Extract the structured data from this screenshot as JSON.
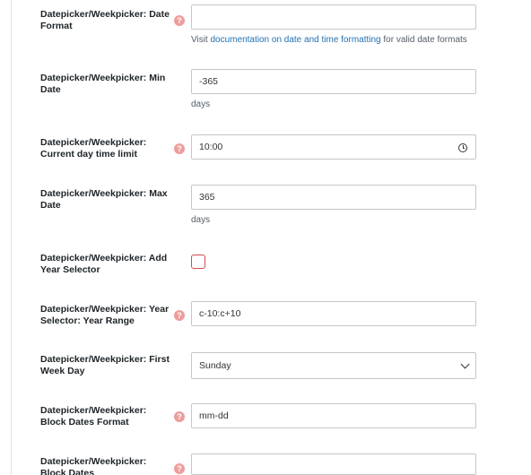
{
  "fields": {
    "date_format": {
      "label": "Datepicker/Weekpicker: Date Format",
      "value": "",
      "hint_prefix": "Visit ",
      "hint_link": "documentation on date and time formatting",
      "hint_suffix": " for valid date formats"
    },
    "min_date": {
      "label": "Datepicker/Weekpicker: Min Date",
      "value": "-365",
      "unit": "days"
    },
    "current_day_time_limit": {
      "label": "Datepicker/Weekpicker: Current day time limit",
      "value": "10:00"
    },
    "max_date": {
      "label": "Datepicker/Weekpicker: Max Date",
      "value": "365",
      "unit": "days"
    },
    "add_year_selector": {
      "label": "Datepicker/Weekpicker: Add Year Selector",
      "checked": false
    },
    "year_range": {
      "label": "Datepicker/Weekpicker: Year Selector: Year Range",
      "value": "c-10:c+10"
    },
    "first_week_day": {
      "label": "Datepicker/Weekpicker: First Week Day",
      "selected": "Sunday"
    },
    "block_dates_format": {
      "label": "Datepicker/Weekpicker: Block Dates Format",
      "value": "mm-dd"
    },
    "block_dates": {
      "label": "Datepicker/Weekpicker: Block Dates",
      "value": ""
    }
  },
  "help_glyph": "?",
  "icons": {
    "help": "question-circle-icon",
    "time": "clock-icon",
    "dropdown": "chevron-down-icon"
  },
  "colors": {
    "help_badge": "#ee9d9d",
    "link": "#2271b1",
    "checkbox_border": "#d24b4b",
    "label_text": "#1d2327"
  }
}
